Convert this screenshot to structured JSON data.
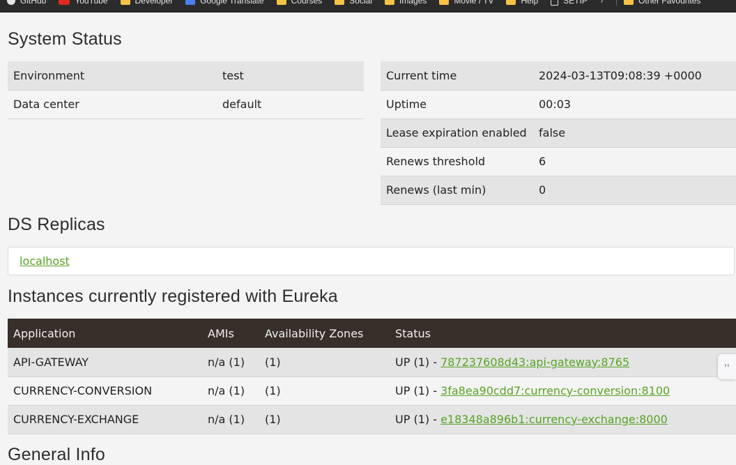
{
  "bookmarks": [
    {
      "label": "GitHub",
      "icon": "github-icon"
    },
    {
      "label": "YouTube",
      "icon": "youtube-icon"
    },
    {
      "label": "Developer",
      "icon": "folder-icon"
    },
    {
      "label": "Google Translate",
      "icon": "google-translate-icon"
    },
    {
      "label": "Courses",
      "icon": "folder-icon"
    },
    {
      "label": "Social",
      "icon": "folder-icon"
    },
    {
      "label": "Images",
      "icon": "folder-icon"
    },
    {
      "label": "Movie / TV",
      "icon": "folder-icon"
    },
    {
      "label": "Help",
      "icon": "folder-icon"
    },
    {
      "label": "SETIP",
      "icon": "page-icon"
    },
    {
      "label": "Other Favourites",
      "icon": "folder-icon"
    }
  ],
  "system_status": {
    "heading": "System Status",
    "left": [
      {
        "label": "Environment",
        "value": "test"
      },
      {
        "label": "Data center",
        "value": "default"
      }
    ],
    "right": [
      {
        "label": "Current time",
        "value": "2024-03-13T09:08:39 +0000"
      },
      {
        "label": "Uptime",
        "value": "00:03"
      },
      {
        "label": "Lease expiration enabled",
        "value": "false"
      },
      {
        "label": "Renews threshold",
        "value": "6"
      },
      {
        "label": "Renews (last min)",
        "value": "0"
      }
    ]
  },
  "replicas": {
    "heading": "DS Replicas",
    "link": "localhost"
  },
  "instances": {
    "heading": "Instances currently registered with Eureka",
    "columns": [
      "Application",
      "AMIs",
      "Availability Zones",
      "Status"
    ],
    "rows": [
      {
        "app": "API-GATEWAY",
        "amis": "n/a (1)",
        "zones": "(1)",
        "status_prefix": "UP (1) - ",
        "instance": "787237608d43:api-gateway:8765"
      },
      {
        "app": "CURRENCY-CONVERSION",
        "amis": "n/a (1)",
        "zones": "(1)",
        "status_prefix": "UP (1) - ",
        "instance": "3fa8ea90cdd7:currency-conversion:8100"
      },
      {
        "app": "CURRENCY-EXCHANGE",
        "amis": "n/a (1)",
        "zones": "(1)",
        "status_prefix": "UP (1) - ",
        "instance": "e18348a896b1:currency-exchange:8000"
      }
    ]
  },
  "general_info": {
    "heading": "General Info"
  },
  "colors": {
    "link": "#58a325",
    "table_header_bg": "#382f2b"
  }
}
